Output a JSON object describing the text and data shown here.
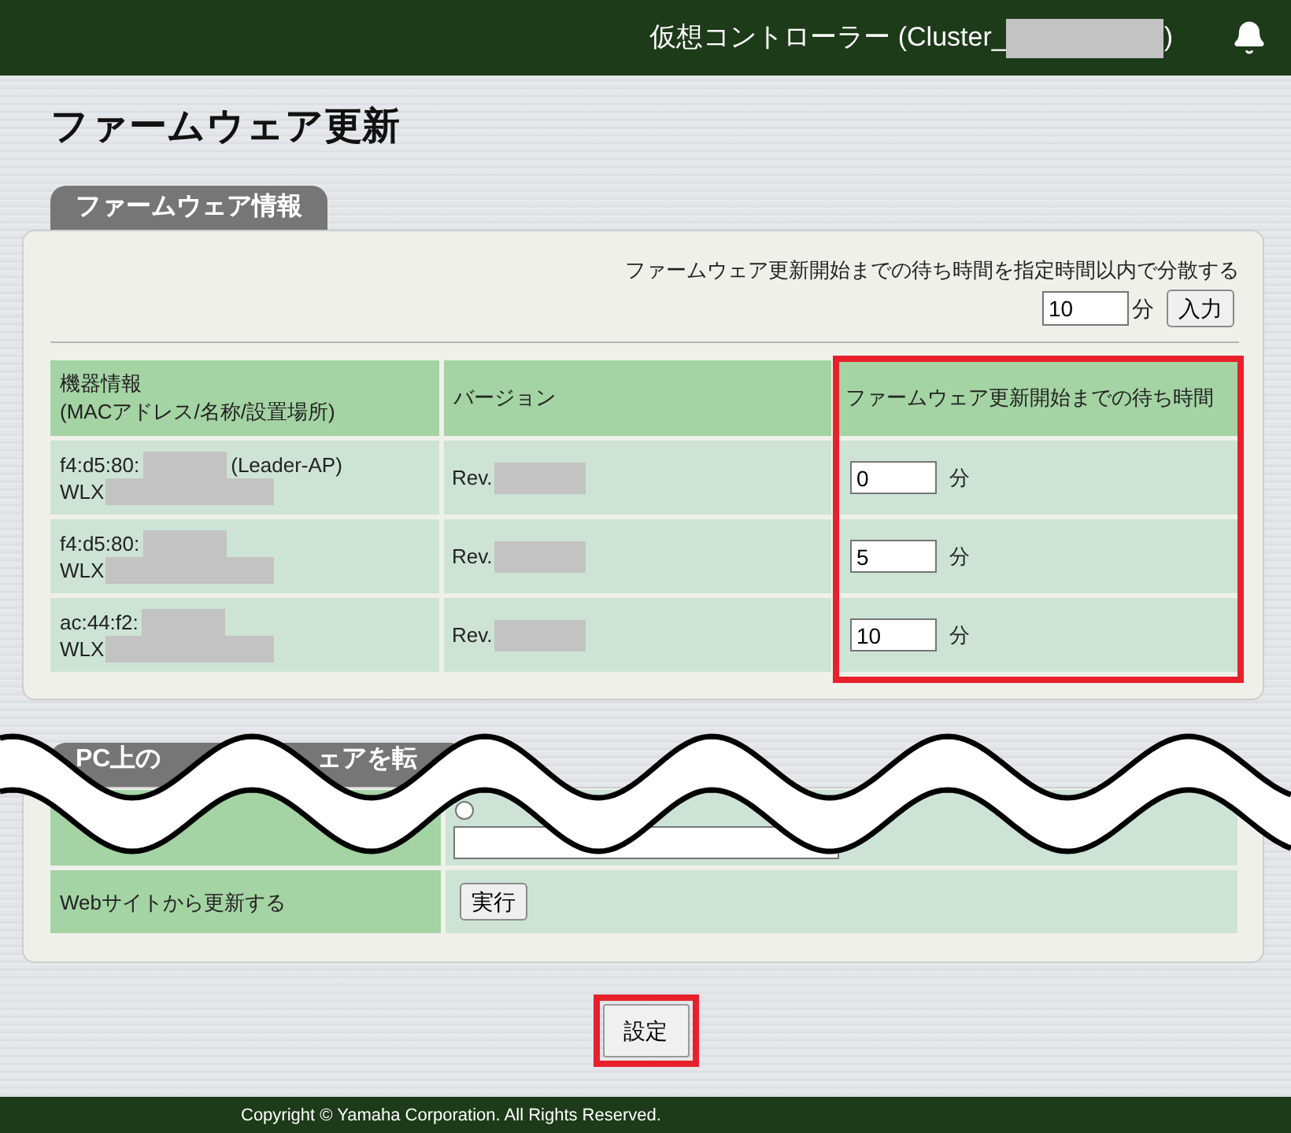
{
  "header": {
    "title": "仮想コントローラー (Cluster_",
    "title_redacted": true,
    "title_end": ")"
  },
  "page_title": "ファームウェア更新",
  "firmware_info": {
    "tab": "ファームウェア情報",
    "spread": {
      "label": "ファームウェア更新開始までの待ち時間を指定時間以内で分散する",
      "value": "10",
      "unit": "分",
      "button": "入力"
    },
    "table": {
      "columns": [
        {
          "lines": [
            "機器情報",
            "(MACアドレス/名称/設置場所)"
          ],
          "highlighted": false
        },
        {
          "lines": [
            "バージョン"
          ],
          "highlighted": false
        },
        {
          "lines": [
            "ファームウェア更新開始までの待ち時間"
          ],
          "highlighted": true
        }
      ],
      "rows": [
        {
          "mac": "f4:d5:80:",
          "mac_redacted": true,
          "role": "(Leader-AP)",
          "name": "WLX",
          "name_redacted": true,
          "version": "Rev.",
          "version_redacted": true,
          "wait": "0",
          "unit": "分"
        },
        {
          "mac": "f4:d5:80:",
          "mac_redacted": true,
          "name": "WLX",
          "name_redacted": true,
          "version": "Rev.",
          "version_redacted": true,
          "wait": "5",
          "unit": "分"
        },
        {
          "mac": "ac:44:f2:",
          "mac_redacted": true,
          "name": "WLX",
          "name_redacted": true,
          "version": "Rev.",
          "version_redacted": true,
          "wait": "10",
          "unit": "分"
        }
      ]
    }
  },
  "transfer": {
    "tab_parts": [
      "PC上の",
      "ェアを転"
    ],
    "radio": {
      "selected": false
    },
    "web_update": {
      "label": "Webサイトから更新する",
      "button": "実行"
    }
  },
  "settings_button": {
    "label": "設定",
    "highlighted": true
  },
  "footer": "Copyright © Yamaha Corporation. All Rights Reserved."
}
